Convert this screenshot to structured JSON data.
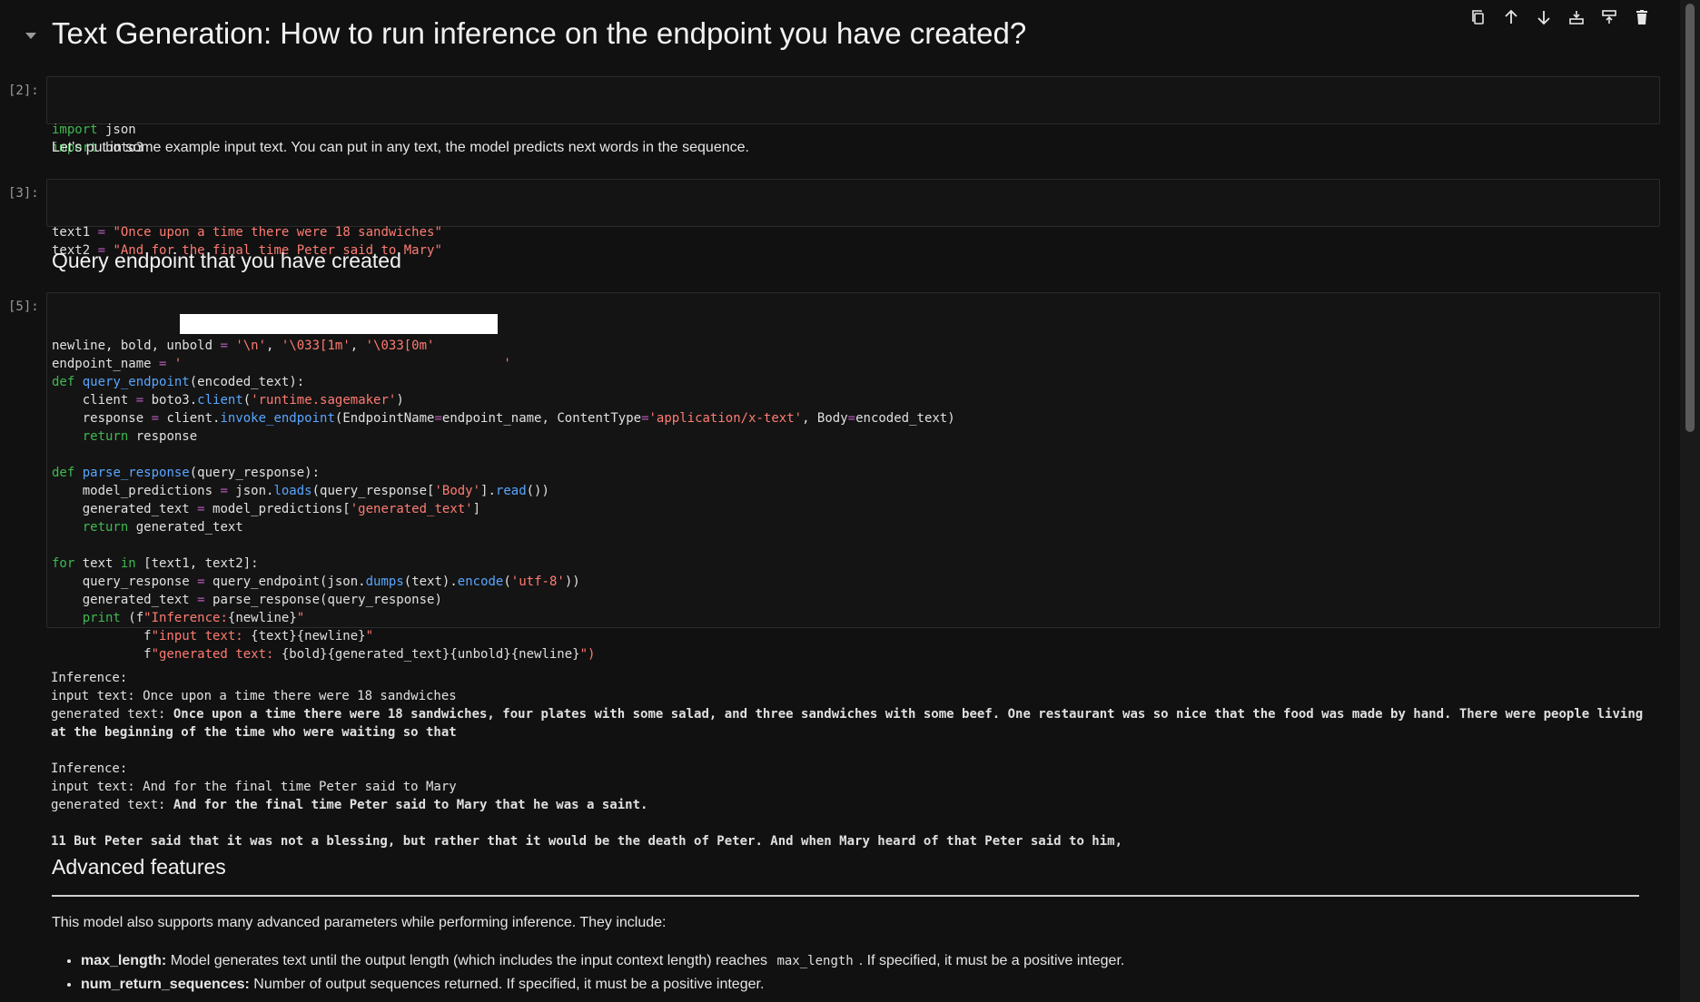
{
  "toolbar": {
    "icons": [
      "copy-icon",
      "arrow-up-icon",
      "arrow-down-icon",
      "insert-above-icon",
      "insert-below-icon",
      "trash-icon"
    ]
  },
  "heading": {
    "title": "Text Generation: How to run inference on the endpoint you have created?"
  },
  "cells": {
    "c2": {
      "prompt": "[2]:",
      "lines": [
        [
          {
            "t": "import",
            "c": "kw"
          },
          {
            "t": " json"
          }
        ],
        [
          {
            "t": "import",
            "c": "kw"
          },
          {
            "t": " boto3"
          }
        ]
      ]
    },
    "md1": {
      "text": "Let's put in some example input text. You can put in any text, the model predicts next words in the sequence."
    },
    "c3": {
      "prompt": "[3]:",
      "lines": [
        [
          {
            "t": "text1 "
          },
          {
            "t": "=",
            "c": "op"
          },
          {
            "t": " "
          },
          {
            "t": "\"Once upon a time there were 18 sandwiches\"",
            "c": "str"
          }
        ],
        [
          {
            "t": "text2 "
          },
          {
            "t": "=",
            "c": "op"
          },
          {
            "t": " "
          },
          {
            "t": "\"And for the final time Peter said to Mary\"",
            "c": "str"
          }
        ]
      ]
    },
    "h_query": {
      "text": "Query endpoint that you have created"
    },
    "c5": {
      "prompt": "[5]:",
      "lines": [
        [
          {
            "t": "newline, bold, unbold "
          },
          {
            "t": "=",
            "c": "op"
          },
          {
            "t": " "
          },
          {
            "t": "'\\n'",
            "c": "str"
          },
          {
            "t": ", "
          },
          {
            "t": "'\\033[1m'",
            "c": "str"
          },
          {
            "t": ", "
          },
          {
            "t": "'\\033[0m'",
            "c": "str"
          }
        ],
        [
          {
            "t": "endpoint_name "
          },
          {
            "t": "=",
            "c": "op"
          },
          {
            "t": " "
          },
          {
            "t": "'",
            "c": "str"
          },
          {
            "t": "                                          "
          },
          {
            "t": "'",
            "c": "str"
          }
        ],
        [
          {
            "t": "def",
            "c": "kw"
          },
          {
            "t": " "
          },
          {
            "t": "query_endpoint",
            "c": "fn"
          },
          {
            "t": "(encoded_text):"
          }
        ],
        [
          {
            "t": "    client "
          },
          {
            "t": "=",
            "c": "op"
          },
          {
            "t": " boto3."
          },
          {
            "t": "client",
            "c": "fn"
          },
          {
            "t": "("
          },
          {
            "t": "'runtime.sagemaker'",
            "c": "str"
          },
          {
            "t": ")"
          }
        ],
        [
          {
            "t": "    response "
          },
          {
            "t": "=",
            "c": "op"
          },
          {
            "t": " client."
          },
          {
            "t": "invoke_endpoint",
            "c": "fn"
          },
          {
            "t": "(EndpointName"
          },
          {
            "t": "=",
            "c": "op"
          },
          {
            "t": "endpoint_name, ContentType"
          },
          {
            "t": "=",
            "c": "op"
          },
          {
            "t": "'application/x-text'",
            "c": "str"
          },
          {
            "t": ", Body"
          },
          {
            "t": "=",
            "c": "op"
          },
          {
            "t": "encoded_text)"
          }
        ],
        [
          {
            "t": "    "
          },
          {
            "t": "return",
            "c": "kw"
          },
          {
            "t": " response"
          }
        ],
        [],
        [
          {
            "t": "def",
            "c": "kw"
          },
          {
            "t": " "
          },
          {
            "t": "parse_response",
            "c": "fn"
          },
          {
            "t": "(query_response):"
          }
        ],
        [
          {
            "t": "    model_predictions "
          },
          {
            "t": "=",
            "c": "op"
          },
          {
            "t": " json."
          },
          {
            "t": "loads",
            "c": "fn"
          },
          {
            "t": "(query_response["
          },
          {
            "t": "'Body'",
            "c": "str"
          },
          {
            "t": "]."
          },
          {
            "t": "read",
            "c": "fn"
          },
          {
            "t": "())"
          }
        ],
        [
          {
            "t": "    generated_text "
          },
          {
            "t": "=",
            "c": "op"
          },
          {
            "t": " model_predictions["
          },
          {
            "t": "'generated_text'",
            "c": "str"
          },
          {
            "t": "]"
          }
        ],
        [
          {
            "t": "    "
          },
          {
            "t": "return",
            "c": "kw"
          },
          {
            "t": " generated_text"
          }
        ],
        [],
        [
          {
            "t": "for",
            "c": "kw"
          },
          {
            "t": " text "
          },
          {
            "t": "in",
            "c": "kw"
          },
          {
            "t": " [text1, text2]:"
          }
        ],
        [
          {
            "t": "    query_response "
          },
          {
            "t": "=",
            "c": "op"
          },
          {
            "t": " query_endpoint(json."
          },
          {
            "t": "dumps",
            "c": "fn"
          },
          {
            "t": "(text)."
          },
          {
            "t": "encode",
            "c": "fn"
          },
          {
            "t": "("
          },
          {
            "t": "'utf-8'",
            "c": "str"
          },
          {
            "t": "))"
          }
        ],
        [
          {
            "t": "    generated_text "
          },
          {
            "t": "=",
            "c": "op"
          },
          {
            "t": " parse_response(query_response)"
          }
        ],
        [
          {
            "t": "    "
          },
          {
            "t": "print",
            "c": "kw"
          },
          {
            "t": " (f"
          },
          {
            "t": "\"Inference:",
            "c": "str"
          },
          {
            "t": "{newline}"
          },
          {
            "t": "\"",
            "c": "str"
          }
        ],
        [
          {
            "t": "            f"
          },
          {
            "t": "\"input text: ",
            "c": "str"
          },
          {
            "t": "{text}{newline}"
          },
          {
            "t": "\"",
            "c": "str"
          }
        ],
        [
          {
            "t": "            f"
          },
          {
            "t": "\"generated text: ",
            "c": "str"
          },
          {
            "t": "{bold}{generated_text}{unbold}{newline}"
          },
          {
            "t": "\")",
            "c": "str"
          }
        ]
      ]
    },
    "out5": {
      "lines": [
        [
          {
            "t": "Inference:"
          }
        ],
        [
          {
            "t": "input text: Once upon a time there were 18 sandwiches"
          }
        ],
        [
          {
            "t": "generated text: "
          },
          {
            "t": "Once upon a time there were 18 sandwiches, four plates with some salad, and three sandwiches with some beef. One restaurant was so nice that the food was made by hand. There were people living at the beginning of the time who were waiting so that",
            "c": "b"
          }
        ],
        [],
        [
          {
            "t": "Inference:"
          }
        ],
        [
          {
            "t": "input text: And for the final time Peter said to Mary"
          }
        ],
        [
          {
            "t": "generated text: "
          },
          {
            "t": "And for the final time Peter said to Mary that he was a saint.",
            "c": "b"
          }
        ],
        [],
        [
          {
            "t": "11 But Peter said that it was not a blessing, but rather that it would be the death of Peter. And when Mary heard of that Peter said to him,",
            "c": "b"
          }
        ]
      ]
    },
    "h_adv": {
      "text": "Advanced features"
    },
    "md2": {
      "text": "This model also supports many advanced parameters while performing inference. They include:"
    },
    "params": [
      {
        "name": "max_length:",
        "pre": " Model generates text until the output length (which includes the input context length) reaches ",
        "code": "max_length",
        "post": ". If specified, it must be a positive integer."
      },
      {
        "name": "num_return_sequences:",
        "pre": " Number of output sequences returned. If specified, it must be a positive integer.",
        "code": "",
        "post": ""
      }
    ]
  }
}
